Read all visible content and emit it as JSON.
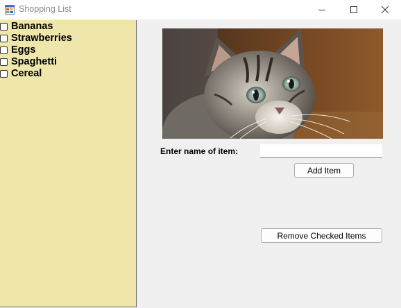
{
  "window": {
    "title": "Shopping List"
  },
  "titlebar": {
    "app_icon": "form-icon",
    "minimize_icon": "minimize-icon",
    "maximize_icon": "maximize-icon",
    "close_icon": "close-icon"
  },
  "shopping_list": {
    "background_color": "#eee6ab",
    "items": [
      {
        "label": "Bananas",
        "checked": false
      },
      {
        "label": "Strawberries",
        "checked": false
      },
      {
        "label": "Eggs",
        "checked": false
      },
      {
        "label": "Spaghetti",
        "checked": false
      },
      {
        "label": "Cereal",
        "checked": false
      }
    ]
  },
  "picture": {
    "subject": "kitten-photo"
  },
  "entry": {
    "label": "Enter name of item:",
    "value": "",
    "placeholder": ""
  },
  "buttons": {
    "add_label": "Add Item",
    "remove_label": "Remove Checked Items"
  }
}
